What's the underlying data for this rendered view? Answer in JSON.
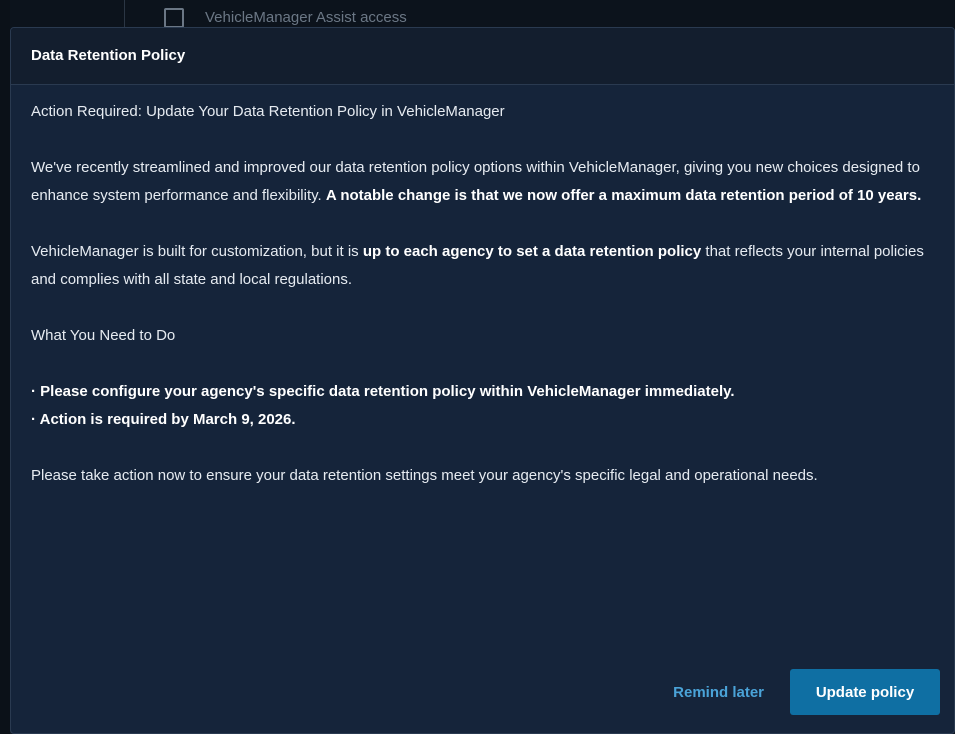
{
  "background": {
    "checkbox_label": "VehicleManager Assist access"
  },
  "dialog": {
    "title": "Data Retention Policy",
    "subtitle": "Action Required: Update Your Data Retention Policy in VehicleManager",
    "paragraph1": {
      "plain": "We've recently streamlined and improved our data retention policy options within VehicleManager, giving you new choices designed to enhance system performance and flexibility. ",
      "bold": "A notable change is that we now offer a maximum data retention period of 10 years."
    },
    "paragraph2": {
      "plain_before": "VehicleManager is built for customization, but it is ",
      "bold": "up to each agency to set a data retention policy",
      "plain_after": " that reflects your internal policies and complies with all state and local regulations."
    },
    "section_heading": "What You Need to Do",
    "bullets": [
      "· Please configure your agency's specific data retention policy within VehicleManager immediately.",
      "· Action is required by March 9, 2026."
    ],
    "closing": "Please take action now to ensure your data retention settings meet your agency's specific legal and operational needs.",
    "remind_label": "Remind later",
    "update_label": "Update policy"
  },
  "colors": {
    "modal_bg": "#15243a",
    "header_bg": "#131e2e",
    "primary_button": "#0f6fa3",
    "link": "#4aa3d8",
    "text": "#e6ebf1"
  }
}
